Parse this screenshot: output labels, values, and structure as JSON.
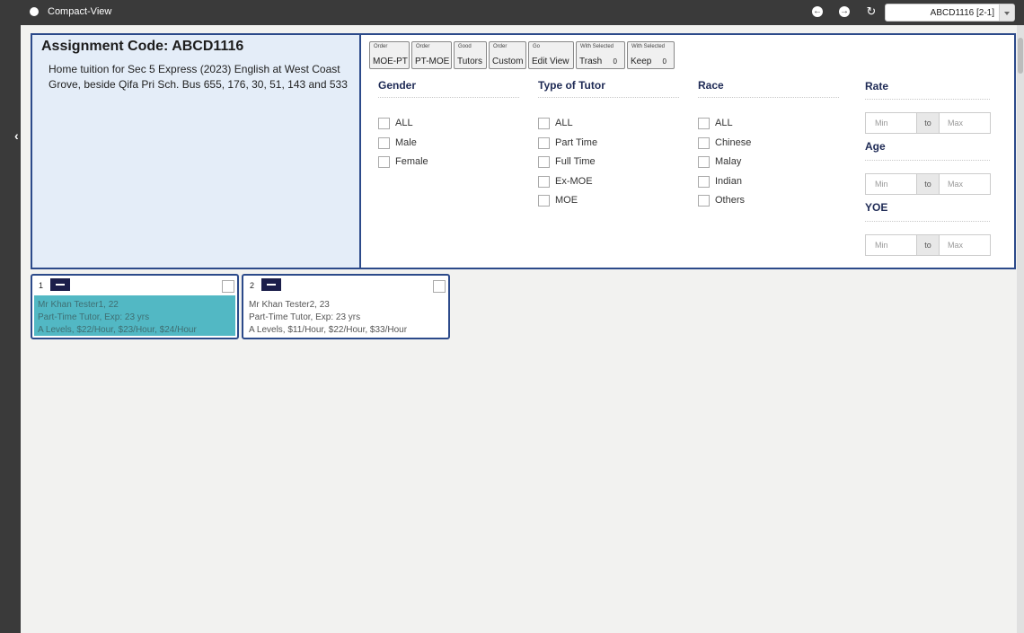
{
  "topbar": {
    "view_label": "Compact-View",
    "assignment_select_value": "ABCD1116 [2-1]"
  },
  "assignment": {
    "title": "Assignment Code: ABCD1116",
    "description": "Home tuition for Sec 5 Express (2023) English at West Coast Grove, beside Qifa Pri Sch. Bus 655, 176, 30, 51, 143 and 533"
  },
  "toolbar": {
    "buttons": [
      {
        "small": "Order",
        "label": "MOE-PT"
      },
      {
        "small": "Order",
        "label": "PT-MOE"
      },
      {
        "small": "Good",
        "label": "Tutors"
      },
      {
        "small": "Order",
        "label": "Custom"
      },
      {
        "small": "Go",
        "label": "Edit View"
      },
      {
        "small": "With Selected",
        "label": "Trash",
        "count": "0"
      },
      {
        "small": "With Selected",
        "label": "Keep",
        "count": "0"
      }
    ]
  },
  "filters": {
    "gender": {
      "title": "Gender",
      "options": [
        "ALL",
        "Male",
        "Female"
      ]
    },
    "tutor_type": {
      "title": "Type of Tutor",
      "options": [
        "ALL",
        "Part Time",
        "Full Time",
        "Ex-MOE",
        "MOE"
      ]
    },
    "race": {
      "title": "Race",
      "options": [
        "ALL",
        "Chinese",
        "Malay",
        "Indian",
        "Others"
      ]
    },
    "rate": {
      "title": "Rate",
      "min_placeholder": "Min",
      "to": "to",
      "max_placeholder": "Max"
    },
    "age": {
      "title": "Age",
      "min_placeholder": "Min",
      "to": "to",
      "max_placeholder": "Max"
    },
    "yoe": {
      "title": "YOE",
      "min_placeholder": "Min",
      "to": "to",
      "max_placeholder": "Max"
    }
  },
  "tutors": [
    {
      "index": "1",
      "selected": true,
      "line1": "Mr Khan Tester1, 22",
      "line2": "Part-Time Tutor, Exp: 23 yrs",
      "line3": "A Levels, $22/Hour, $23/Hour, $24/Hour"
    },
    {
      "index": "2",
      "selected": false,
      "line1": "Mr Khan Tester2, 23",
      "line2": "Part-Time Tutor, Exp: 23 yrs",
      "line3": "A Levels, $11/Hour, $22/Hour, $33/Hour"
    }
  ],
  "colors": {
    "topbar": "#3a3a3a",
    "border_accent": "#2c4a8a",
    "selected_card": "#52b8c4",
    "heading_text": "#1e2a55"
  }
}
